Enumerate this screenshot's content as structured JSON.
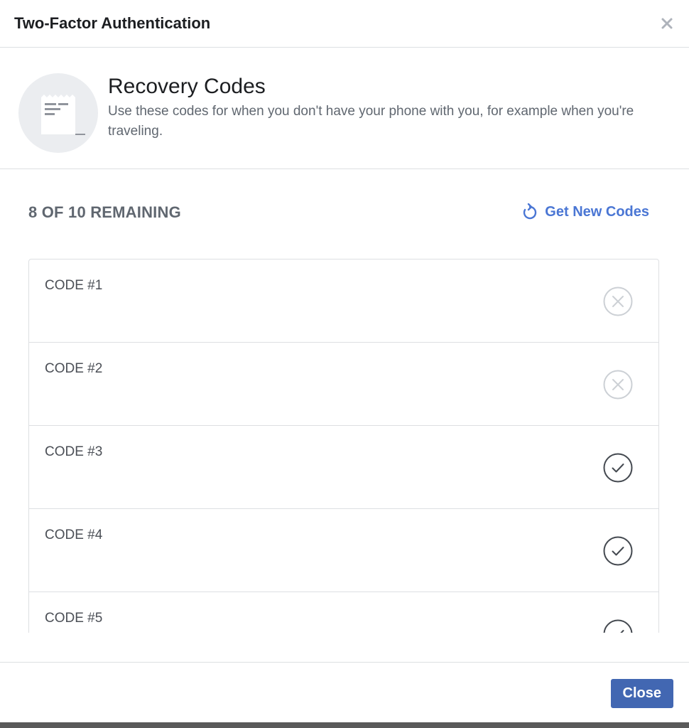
{
  "dialog": {
    "title": "Two-Factor Authentication",
    "close_icon": "close-icon"
  },
  "intro": {
    "icon": "receipt-icon",
    "title": "Recovery Codes",
    "description": "Use these codes for when you don't have your phone with you, for example when you're traveling."
  },
  "codes": {
    "remaining_text": "8 OF 10 REMAINING",
    "get_new_label": "Get New Codes",
    "get_new_icon": "refresh-icon",
    "items": [
      {
        "label": "CODE #1",
        "status": "used",
        "icon": "x-circle-icon"
      },
      {
        "label": "CODE #2",
        "status": "used",
        "icon": "x-circle-icon"
      },
      {
        "label": "CODE #3",
        "status": "available",
        "icon": "check-circle-icon"
      },
      {
        "label": "CODE #4",
        "status": "available",
        "icon": "check-circle-icon"
      },
      {
        "label": "CODE #5",
        "status": "available",
        "icon": "check-circle-icon"
      }
    ]
  },
  "footer": {
    "close_label": "Close"
  },
  "colors": {
    "accent": "#4267b2",
    "link": "#4a76d4",
    "border": "#dddfe2",
    "used_icon": "#ccd0d5",
    "available_icon": "#444950"
  }
}
